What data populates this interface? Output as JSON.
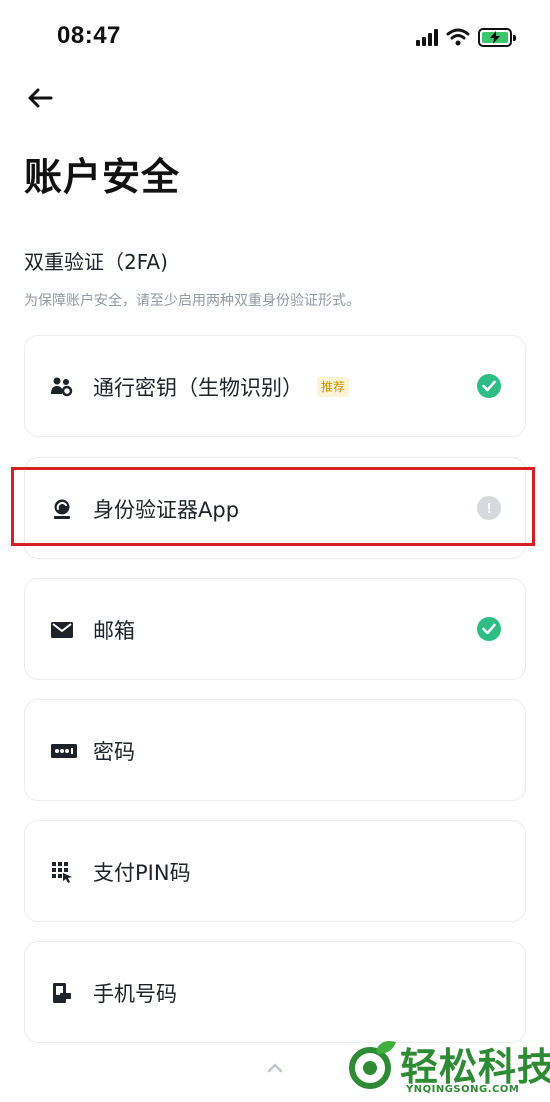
{
  "status_bar": {
    "time": "08:47"
  },
  "page": {
    "title": "账户安全",
    "section_title": "双重验证（2FA)",
    "section_desc": "为保障账户安全，请至少启用两种双重身份验证形式。"
  },
  "items": [
    {
      "label": "通行密钥（生物识别）",
      "badge": "推荐",
      "icon": "passkey-icon",
      "status": "enabled"
    },
    {
      "label": "身份验证器App",
      "icon": "authenticator-icon",
      "status": "warning",
      "status_glyph": "!"
    },
    {
      "label": "邮箱",
      "icon": "mail-icon",
      "status": "enabled"
    },
    {
      "label": "密码",
      "icon": "password-icon"
    },
    {
      "label": "支付PIN码",
      "icon": "pin-keypad-icon"
    },
    {
      "label": "手机号码",
      "icon": "phone-icon"
    }
  ],
  "colors": {
    "success": "#2EBD85",
    "warning_gray": "#D5D8DC",
    "highlight_red": "#D42127",
    "badge_bg": "#FCF4D6",
    "badge_text": "#C99400"
  },
  "watermark": {
    "brand": "轻松科技",
    "url": "YNQINGSONG.COM"
  }
}
